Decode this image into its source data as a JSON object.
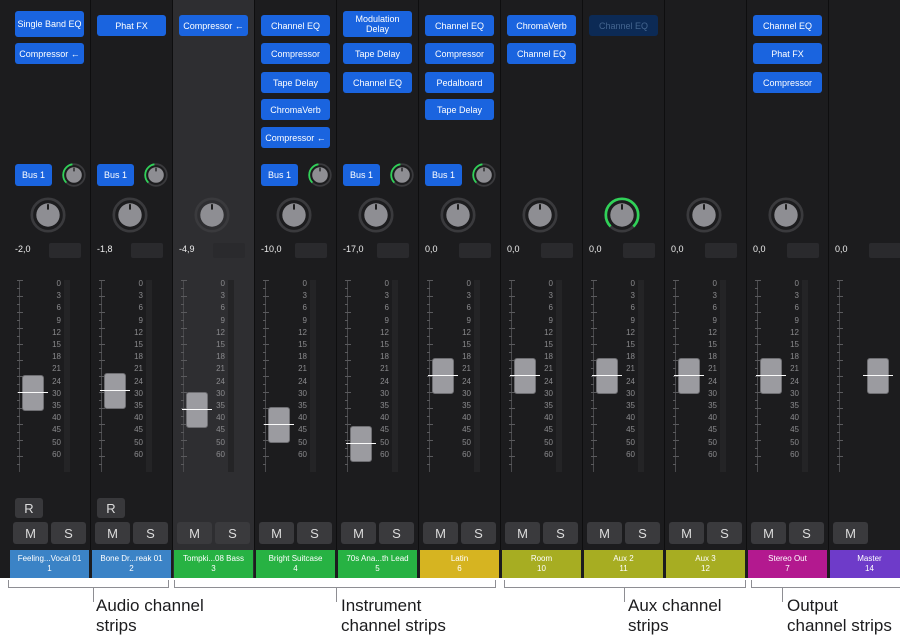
{
  "strips": [
    {
      "plugins": [
        "Single Band EQ",
        "Compressor ←"
      ],
      "bus": "Bus 1",
      "send_knob": true,
      "value": "-2,0",
      "fader": 0.62,
      "r": "R",
      "mute": "M",
      "solo": "S",
      "name": "Feeling...Vocal 01",
      "number": "1",
      "color": "#3b83c6"
    },
    {
      "plugins": [
        "Phat FX"
      ],
      "bus": "Bus 1",
      "send_knob": true,
      "value": "-1,8",
      "fader": 0.63,
      "r": "R",
      "mute": "M",
      "solo": "S",
      "name": "Bone Dr...reak 01",
      "number": "2",
      "color": "#3b83c6"
    },
    {
      "plugins": [
        "Compressor ←"
      ],
      "value": "-4,9",
      "fader": 0.52,
      "mute": "M",
      "solo": "S",
      "name": "Tompki...08 Bass",
      "number": "3",
      "color": "#27b243",
      "selected": true
    },
    {
      "plugins": [
        "Channel EQ",
        "Compressor",
        "Tape Delay",
        "ChromaVerb",
        "Compressor ←"
      ],
      "bus": "Bus 1",
      "send_knob": true,
      "value": "-10,0",
      "fader": 0.43,
      "mute": "M",
      "solo": "S",
      "name": "Bright Suitcase",
      "number": "4",
      "color": "#27b243"
    },
    {
      "plugins": [
        "Modulation Delay",
        "Tape Delay",
        "Channel EQ"
      ],
      "bus": "Bus 1",
      "send_knob": true,
      "value": "-17,0",
      "fader": 0.32,
      "mute": "M",
      "solo": "S",
      "name": "70s Ana...th Lead",
      "number": "5",
      "color": "#27b243"
    },
    {
      "plugins": [
        "Channel EQ",
        "Compressor",
        "Pedalboard",
        "Tape Delay"
      ],
      "bus": "Bus 1",
      "send_knob": true,
      "value": "0,0",
      "fader": 0.72,
      "mute": "M",
      "solo": "S",
      "name": "Latin",
      "number": "6",
      "color": "#d6b421"
    },
    {
      "plugins": [
        "ChromaVerb",
        "Channel EQ"
      ],
      "value": "0,0",
      "fader": 0.72,
      "mute": "M",
      "solo": "S",
      "name": "Room",
      "number": "10",
      "color": "#a7ad22"
    },
    {
      "plugins": [
        "Channel EQ"
      ],
      "plugins_dim": true,
      "value": "0,0",
      "fader": 0.72,
      "mute": "M",
      "solo": "S",
      "name": "Aux 2",
      "number": "11",
      "color": "#a7ad22",
      "pan_green": true
    },
    {
      "plugins": [],
      "value": "0,0",
      "fader": 0.72,
      "mute": "M",
      "solo": "S",
      "name": "Aux 3",
      "number": "12",
      "color": "#a7ad22"
    },
    {
      "plugins": [
        "Channel EQ",
        "Phat FX",
        "Compressor"
      ],
      "value": "0,0",
      "fader": 0.72,
      "mute": "M",
      "solo": "S",
      "name": "Stereo Out",
      "number": "7",
      "color": "#b3198f"
    },
    {
      "plugins": [],
      "no_pan": true,
      "value": "0,0",
      "fader": 0.72,
      "mute": "M",
      "name": "Master",
      "number": "14",
      "color": "#6e3bc9"
    }
  ],
  "scale_labels": [
    "0",
    "3",
    "6",
    "9",
    "12",
    "15",
    "18",
    "21",
    "24",
    "30",
    "35",
    "40",
    "45",
    "50",
    "60"
  ],
  "captions": [
    {
      "line1": "Audio channel",
      "line2": "strips"
    },
    {
      "line1": "Instrument",
      "line2": "channel strips"
    },
    {
      "line1": "Aux channel",
      "line2": "strips"
    },
    {
      "line1": "Output",
      "line2": "channel strips"
    }
  ],
  "colors": {
    "accent": "#1a64df",
    "send_ring": "#30d158",
    "background": "#1c1c1e"
  }
}
